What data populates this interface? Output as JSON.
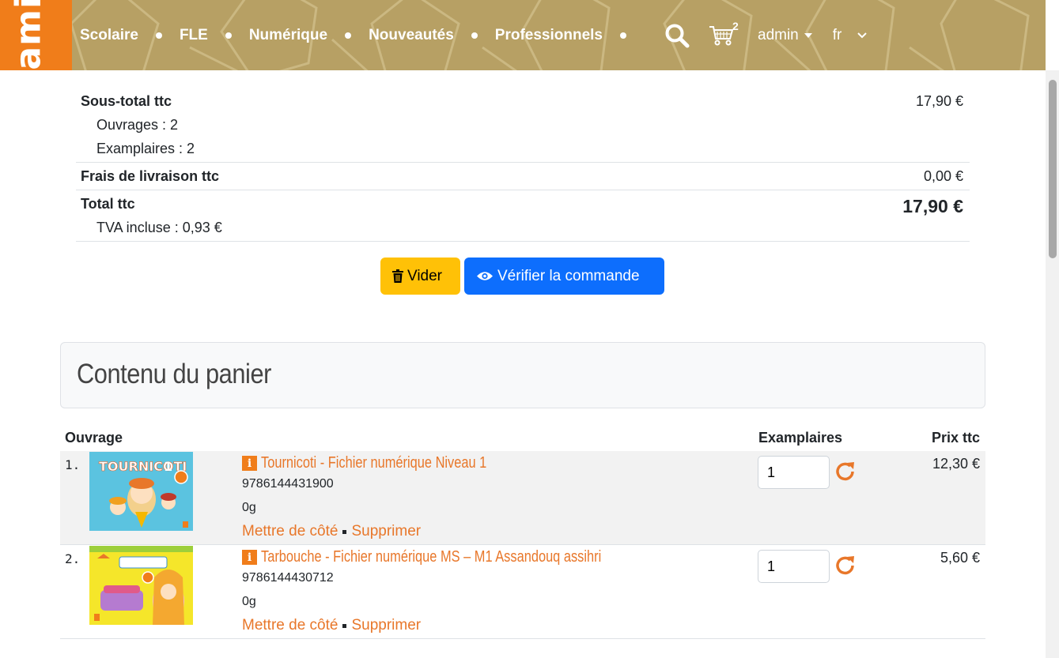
{
  "brand": {
    "logo_text": "samir",
    "colors": {
      "header": "#b7a064",
      "logo": "#f07d1a",
      "accent": "#e8772a",
      "primary": "#0d6efd",
      "warning": "#ffc107"
    }
  },
  "nav": {
    "links": [
      "Scolaire",
      "FLE",
      "Numérique",
      "Nouveautés",
      "Professionnels"
    ],
    "cart_count": "2",
    "user": "admin",
    "lang": "fr",
    "icons": [
      "search-icon",
      "cart-icon",
      "chevron-down-icon"
    ]
  },
  "summary": {
    "subtotal_label": "Sous-total ttc",
    "subtotal_value": "17,90 €",
    "ouvrages": "Ouvrages : 2",
    "examplaires": "Examplaires : 2",
    "shipping_label": "Frais de livraison ttc",
    "shipping_value": "0,00 €",
    "total_label": "Total ttc",
    "total_value": "17,90 €",
    "tva": "TVA incluse : 0,93 €"
  },
  "actions": {
    "empty_label": "Vider",
    "verify_label": "Vérifier la commande"
  },
  "cart": {
    "title": "Contenu du panier",
    "columns": {
      "ouvrage": "Ouvrage",
      "examplaires": "Examplaires",
      "prix": "Prix ttc"
    },
    "items": [
      {
        "num": "1.",
        "info": "i",
        "title": "Tournicoti - Fichier numérique Niveau 1",
        "isbn": "9786144431900",
        "weight": "0g",
        "qty": "1",
        "price": "12,30 €",
        "set_aside": "Mettre de côté",
        "remove": "Supprimer"
      },
      {
        "num": "2.",
        "info": "i",
        "title": "Tarbouche - Fichier numérique MS – M1 Assandouq assihri",
        "isbn": "9786144430712",
        "weight": "0g",
        "qty": "1",
        "price": "5,60 €",
        "set_aside": "Mettre de côté",
        "remove": "Supprimer"
      }
    ]
  }
}
